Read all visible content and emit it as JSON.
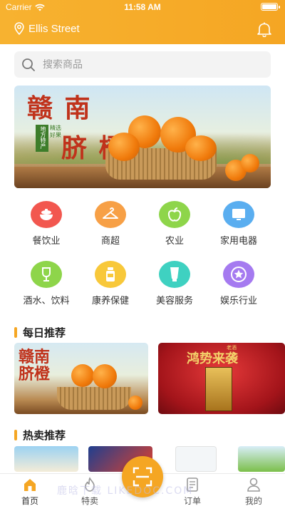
{
  "status_bar": {
    "carrier": "Carrier",
    "time": "11:58 AM",
    "battery_level": 1.0
  },
  "header": {
    "location": "Ellis Street",
    "location_icon": "pin-icon",
    "notification_icon": "bell-icon",
    "accent_color": "#f5a623"
  },
  "search": {
    "placeholder": "搜索商品",
    "icon": "search-icon"
  },
  "banner": {
    "title_line1": "赣 南",
    "title_line2": "脐 橙",
    "tag": "地方特产",
    "sub": "精选好果"
  },
  "categories": [
    {
      "label": "餐饮业",
      "icon": "bowl-icon",
      "color": "#f2574f"
    },
    {
      "label": "商超",
      "icon": "hanger-icon",
      "color": "#f7a046"
    },
    {
      "label": "农业",
      "icon": "apple-icon",
      "color": "#8ed54a"
    },
    {
      "label": "家用电器",
      "icon": "monitor-icon",
      "color": "#5aaef0"
    },
    {
      "label": "酒水、饮料",
      "icon": "wine-glass-icon",
      "color": "#8ed54a"
    },
    {
      "label": "康养保健",
      "icon": "supplement-bottle-icon",
      "color": "#f8c83a"
    },
    {
      "label": "美容服务",
      "icon": "cosmetic-tube-icon",
      "color": "#3fd1c1"
    },
    {
      "label": "娱乐行业",
      "icon": "star-badge-icon",
      "color": "#a57af0"
    }
  ],
  "daily_recommend": {
    "title": "每日推荐",
    "items": [
      {
        "title": "赣南脐橙"
      },
      {
        "title": "鸿势来袭",
        "tag": "老酒"
      }
    ]
  },
  "hot_recommend": {
    "title": "热卖推荐"
  },
  "tabbar": {
    "tabs": [
      {
        "label": "首页",
        "icon": "home-icon",
        "active": true
      },
      {
        "label": "特卖",
        "icon": "flame-icon",
        "active": false
      },
      {
        "label": "订单",
        "icon": "order-list-icon",
        "active": false
      },
      {
        "label": "我的",
        "icon": "user-icon",
        "active": false
      }
    ],
    "center_icon": "scan-icon"
  },
  "watermark": "鹿晗下载 LIKEDOC.COM"
}
